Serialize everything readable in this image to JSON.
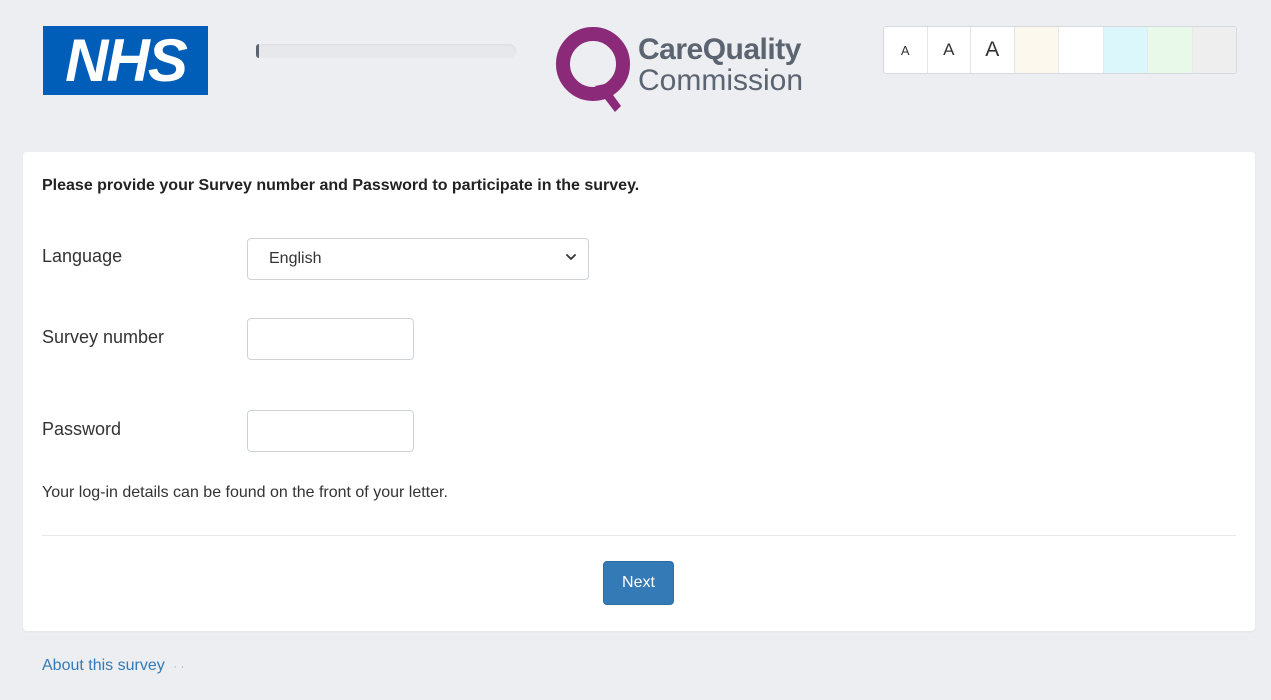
{
  "header": {
    "nhs_logo_text": "NHS",
    "progress_fraction": 0.01,
    "cqc_logo": {
      "line1": "CareQuality",
      "line2": "Commission"
    },
    "accessibility": {
      "text_sizes": [
        "A",
        "A",
        "A"
      ],
      "color_swatches": [
        "#fcf8ee",
        "#ffffff",
        "#dcf7fb",
        "#e8f8e9",
        "#eeeeee"
      ]
    }
  },
  "form": {
    "instruction": "Please provide your Survey number and Password to participate in the survey.",
    "language_label": "Language",
    "language_value": "English",
    "survey_number_label": "Survey number",
    "survey_number_value": "",
    "password_label": "Password",
    "password_value": "",
    "help_text": "Your log-in details can be found on the front of your letter.",
    "next_button": "Next"
  },
  "footer": {
    "about_link": "About this survey",
    "separator": "· ·"
  },
  "colors": {
    "page_background": "#eceef1",
    "nhs_blue": "#005eb8",
    "cqc_purple": "#8a2a78",
    "cqc_grey": "#5b6470",
    "primary_button": "#337ab7",
    "link": "#337ab7"
  },
  "icons": {
    "select_arrow": "chevron-down-icon",
    "cqc_mark": "cqc-q-logo-icon"
  }
}
